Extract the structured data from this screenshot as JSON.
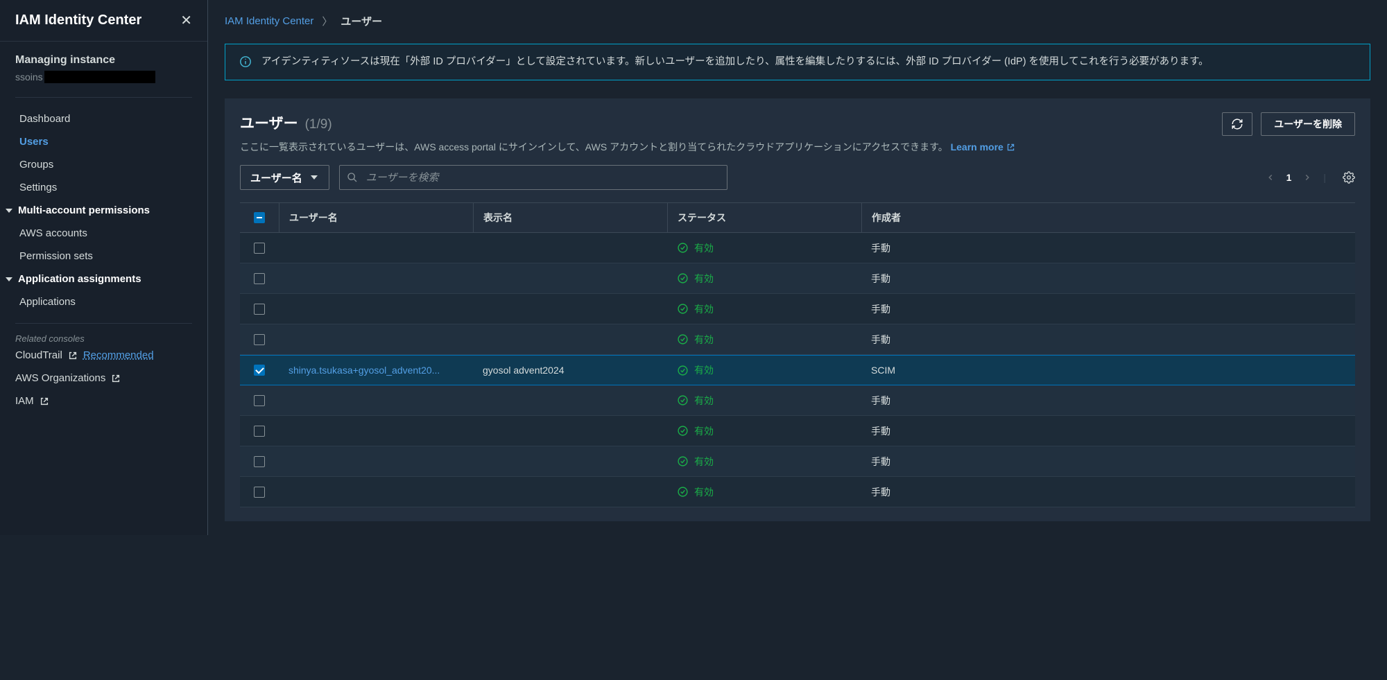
{
  "sidebar": {
    "title": "IAM Identity Center",
    "managing_label": "Managing instance",
    "managing_prefix": "ssoins",
    "nav": {
      "dashboard": "Dashboard",
      "users": "Users",
      "groups": "Groups",
      "settings": "Settings"
    },
    "section_multi": "Multi-account permissions",
    "section_multi_items": {
      "aws_accounts": "AWS accounts",
      "permission_sets": "Permission sets"
    },
    "section_app": "Application assignments",
    "section_app_items": {
      "applications": "Applications"
    },
    "related_label": "Related consoles",
    "related": {
      "cloudtrail": "CloudTrail",
      "recommended": "Recommended",
      "orgs": "AWS Organizations",
      "iam": "IAM"
    }
  },
  "breadcrumb": {
    "root": "IAM Identity Center",
    "current": "ユーザー"
  },
  "info_banner": "アイデンティティソースは現在「外部 ID プロバイダー」として設定されています。新しいユーザーを追加したり、属性を編集したりするには、外部 ID プロバイダー (IdP) を使用してこれを行う必要があります。",
  "panel": {
    "title": "ユーザー",
    "count": "(1/9)",
    "delete_button": "ユーザーを削除",
    "description": "ここに一覧表示されているユーザーは、AWS access portal にサインインして、AWS アカウントと割り当てられたクラウドアプリケーションにアクセスできます。",
    "learn_more": "Learn more",
    "filter_dropdown": "ユーザー名",
    "search_placeholder": "ユーザーを検索",
    "page": "1"
  },
  "table": {
    "headers": {
      "username": "ユーザー名",
      "display_name": "表示名",
      "status": "ステータス",
      "created_by": "作成者"
    },
    "status_label": "有効",
    "created_manual": "手動",
    "created_scim": "SCIM",
    "rows": [
      {
        "selected": false,
        "redacted": true,
        "username": "",
        "display_name": "",
        "created_by": "手動"
      },
      {
        "selected": false,
        "redacted": true,
        "username": "",
        "display_name": "",
        "created_by": "手動"
      },
      {
        "selected": false,
        "redacted": true,
        "username": "",
        "display_name": "",
        "created_by": "手動"
      },
      {
        "selected": false,
        "redacted": true,
        "username": "",
        "display_name": "",
        "created_by": "手動"
      },
      {
        "selected": true,
        "redacted": false,
        "username": "shinya.tsukasa+gyosol_advent20...",
        "display_name": "gyosol advent2024",
        "created_by": "SCIM"
      },
      {
        "selected": false,
        "redacted": true,
        "username": "",
        "display_name": "",
        "created_by": "手動"
      },
      {
        "selected": false,
        "redacted": true,
        "username": "",
        "display_name": "",
        "created_by": "手動"
      },
      {
        "selected": false,
        "redacted": true,
        "username": "",
        "display_name": "",
        "created_by": "手動"
      },
      {
        "selected": false,
        "redacted": true,
        "username": "",
        "display_name": "",
        "created_by": "手動"
      }
    ]
  }
}
